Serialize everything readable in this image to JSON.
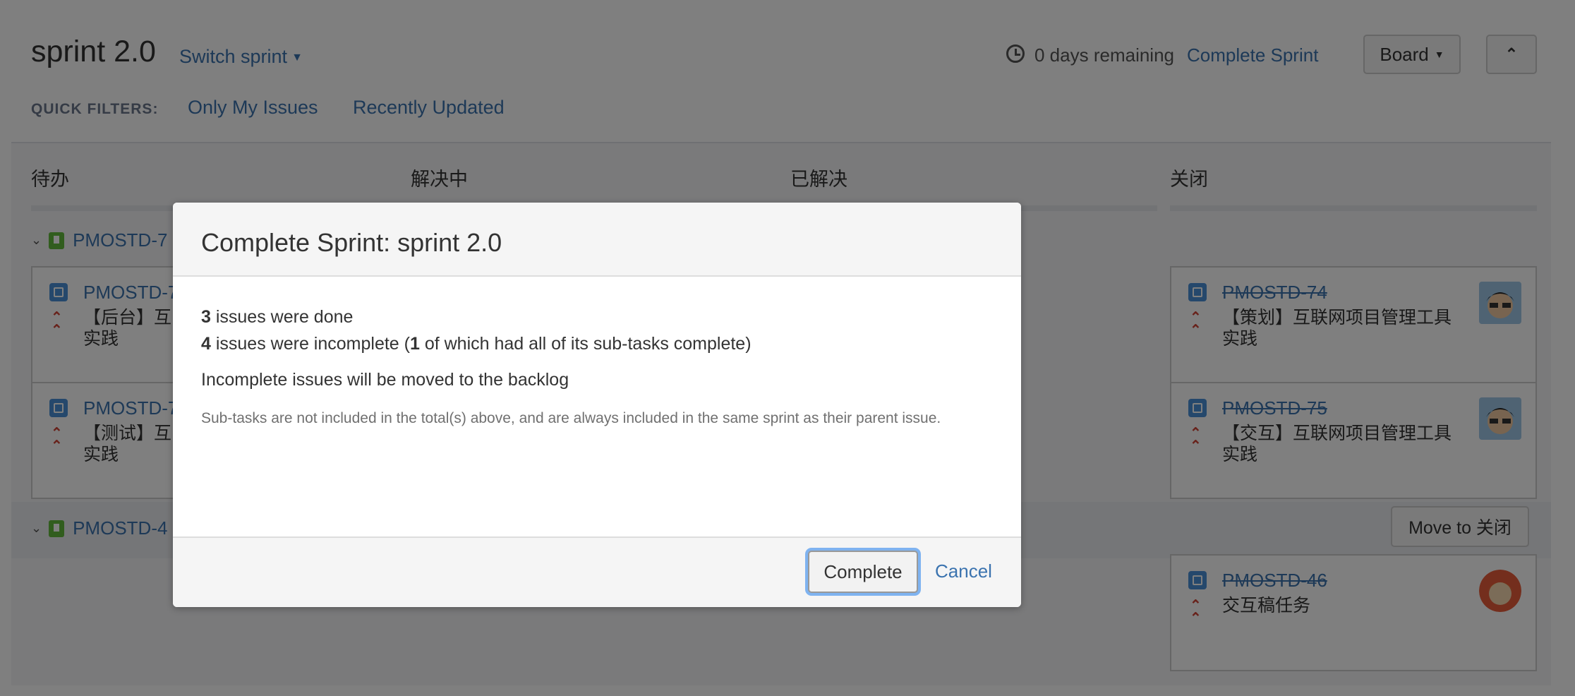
{
  "header": {
    "sprint_title": "sprint 2.0",
    "switch_sprint": "Switch sprint",
    "quick_filters_label": "QUICK FILTERS:",
    "quick_filters": [
      "Only My Issues",
      "Recently Updated"
    ],
    "days_remaining": "0 days remaining",
    "complete_sprint": "Complete Sprint",
    "board_button": "Board"
  },
  "columns": [
    "待办",
    "解决中",
    "已解决",
    "关闭"
  ],
  "swimlanes": [
    {
      "key": "PMOSTD-7"
    },
    {
      "key": "PMOSTD-4"
    }
  ],
  "cards": {
    "todo_1": {
      "key": "PMOSTD-7",
      "summary": "【后台】互\n实践"
    },
    "todo_2": {
      "key": "PMOSTD-7",
      "summary": "【测试】互\n实践"
    },
    "closed_1": {
      "key": "PMOSTD-74",
      "summary": "【策划】互联网项目管理工具\n实践"
    },
    "closed_2": {
      "key": "PMOSTD-75",
      "summary": "【交互】互联网项目管理工具\n实践"
    },
    "closed_3": {
      "key": "PMOSTD-46",
      "summary": "交互稿任务"
    }
  },
  "move_button": "Move to 关闭",
  "dialog": {
    "title": "Complete Sprint: sprint 2.0",
    "done_count": "3",
    "done_text": " issues were done",
    "incomplete_count": "4",
    "incomplete_text_a": " issues were incomplete (",
    "incomplete_sub_count": "1",
    "incomplete_text_b": " of which had all of its sub-tasks complete)",
    "move_text": "Incomplete issues will be moved to the backlog",
    "note": "Sub-tasks are not included in the total(s) above, and are always included in the same sprint as their parent issue.",
    "complete_button": "Complete",
    "cancel": "Cancel"
  },
  "colors": {
    "link": "#3b73af",
    "priority": "#d04437",
    "story": "#63ba3c",
    "task": "#4a90d9",
    "focus": "#7fb3f0"
  },
  "icons": [
    "clock-icon",
    "caret-down-icon",
    "double-chevron-up-icon",
    "chevron-down-icon",
    "story-icon",
    "task-icon",
    "priority-highest-icon",
    "avatar"
  ]
}
